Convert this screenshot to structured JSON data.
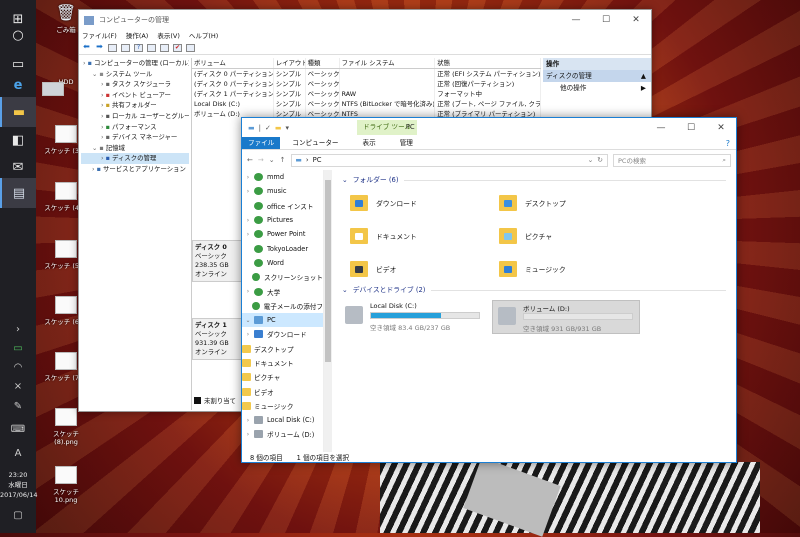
{
  "desktop": {
    "icons": [
      {
        "label": "ごみ箱"
      },
      {
        "label": "HDD"
      },
      {
        "label": "スケッチ (3).p"
      },
      {
        "label": "スケッチ (4).p"
      },
      {
        "label": "スケッチ (5).p"
      },
      {
        "label": "スケッチ (6).p"
      },
      {
        "label": "スケッチ (7).p"
      },
      {
        "label": "スケッチ (8).png"
      },
      {
        "label": "スケッチ10.png"
      }
    ]
  },
  "taskbar": {
    "time": "23:20",
    "weekday": "水曜日",
    "date": "2017/06/14",
    "ime": "A"
  },
  "compmgmt": {
    "title": "コンピューターの管理",
    "menu": [
      "ファイル(F)",
      "操作(A)",
      "表示(V)",
      "ヘルプ(H)"
    ],
    "tree": [
      {
        "label": "コンピューターの管理 (ローカル)",
        "indent": 0
      },
      {
        "label": "システム ツール",
        "indent": 1
      },
      {
        "label": "タスク スケジューラ",
        "indent": 2
      },
      {
        "label": "イベント ビューアー",
        "indent": 2
      },
      {
        "label": "共有フォルダー",
        "indent": 2
      },
      {
        "label": "ローカル ユーザーとグループ",
        "indent": 2
      },
      {
        "label": "パフォーマンス",
        "indent": 2
      },
      {
        "label": "デバイス マネージャー",
        "indent": 2
      },
      {
        "label": "記憶域",
        "indent": 1
      },
      {
        "label": "ディスクの管理",
        "indent": 2,
        "selected": true
      },
      {
        "label": "サービスとアプリケーション",
        "indent": 1
      }
    ],
    "columns": [
      "ボリューム",
      "レイアウト",
      "種類",
      "ファイル システム",
      "状態"
    ],
    "volumes": [
      [
        "(ディスク 0 パーティション 1)",
        "シンプル",
        "ベーシック",
        "",
        "正常 (EFI システム パーティション)"
      ],
      [
        "(ディスク 0 パーティション 4)",
        "シンプル",
        "ベーシック",
        "",
        "正常 (回復パーティション)"
      ],
      [
        "(ディスク 1 パーティション 2)",
        "シンプル",
        "ベーシック",
        "RAW",
        "フォーマット中"
      ],
      [
        "Local Disk (C:)",
        "シンプル",
        "ベーシック",
        "NTFS (BitLocker で暗号化済み)",
        "正常 (ブート, ページ ファイル, クラッシュ"
      ],
      [
        "ボリューム (D:)",
        "シンプル",
        "ベーシック",
        "NTFS",
        "正常 (プライマリ パーティション)"
      ]
    ],
    "disks": [
      {
        "name": "ディスク 0",
        "type": "ベーシック",
        "size": "238.35 GB",
        "status": "オンライン"
      },
      {
        "name": "ディスク 1",
        "type": "ベーシック",
        "size": "931.39 GB",
        "status": "オンライン"
      }
    ],
    "legend": "未割り当て",
    "ops_header": "操作",
    "ops_section": "ディスクの管理",
    "ops_item": "他の操作"
  },
  "explorer": {
    "context_tab": "ドライブ ツール",
    "title": "PC",
    "tabs": [
      "ファイル",
      "コンピューター",
      "表示",
      "管理"
    ],
    "address": "PC",
    "search_placeholder": "PCの検索",
    "nav": [
      {
        "label": "mmd",
        "icon": "green",
        "arrow": "›"
      },
      {
        "label": "music",
        "icon": "green",
        "arrow": "›"
      },
      {
        "label": "office インスト",
        "icon": "green",
        "arrow": ""
      },
      {
        "label": "Pictures",
        "icon": "green",
        "arrow": "›"
      },
      {
        "label": "Power Point",
        "icon": "green",
        "arrow": "›"
      },
      {
        "label": "TokyoLoader",
        "icon": "green",
        "arrow": ""
      },
      {
        "label": "Word",
        "icon": "green",
        "arrow": ""
      },
      {
        "label": "スクリーンショット",
        "icon": "green",
        "arrow": ""
      },
      {
        "label": "大学",
        "icon": "green",
        "arrow": "›"
      },
      {
        "label": "電子メールの添付フ",
        "icon": "green",
        "arrow": ""
      },
      {
        "label": "PC",
        "icon": "pc",
        "arrow": "⌄",
        "selected": true
      },
      {
        "label": "ダウンロード",
        "icon": "dl",
        "arrow": "›"
      },
      {
        "label": "デスクトップ",
        "icon": "fold",
        "arrow": "›"
      },
      {
        "label": "ドキュメント",
        "icon": "fold",
        "arrow": "›"
      },
      {
        "label": "ピクチャ",
        "icon": "fold",
        "arrow": "›"
      },
      {
        "label": "ビデオ",
        "icon": "fold",
        "arrow": "›"
      },
      {
        "label": "ミュージック",
        "icon": "fold",
        "arrow": "›"
      },
      {
        "label": "Local Disk (C:)",
        "icon": "drv",
        "arrow": "›"
      },
      {
        "label": "ボリューム (D:)",
        "icon": "drv",
        "arrow": "›"
      }
    ],
    "folders_header": "フォルダー (6)",
    "folders": [
      {
        "label": "ダウンロード",
        "overlay": "#2f7ed6"
      },
      {
        "label": "デスクトップ",
        "overlay": "#3a8fe0"
      },
      {
        "label": "ドキュメント",
        "overlay": "#ffffff"
      },
      {
        "label": "ピクチャ",
        "overlay": "#7fc6ef"
      },
      {
        "label": "ビデオ",
        "overlay": "#333a46"
      },
      {
        "label": "ミュージック",
        "overlay": "#2f7ed6"
      }
    ],
    "drives_header": "デバイスとドライブ (2)",
    "drives": [
      {
        "name": "Local Disk (C:)",
        "space": "空き領域 83.4 GB/237 GB",
        "used_fraction": 0.648
      },
      {
        "name": "ボリューム (D:)",
        "space": "空き領域 931 GB/931 GB",
        "used_fraction": 0.0,
        "selected": true
      }
    ],
    "status_items": "8 個の項目",
    "status_selected": "1 個の項目を選択"
  }
}
